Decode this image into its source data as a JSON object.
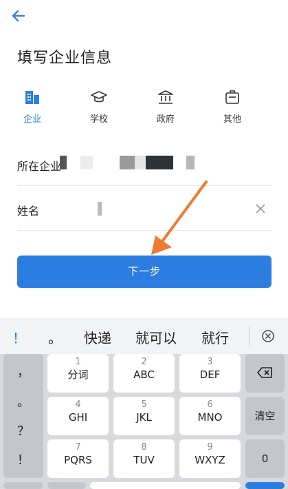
{
  "header": {
    "title": "填写企业信息"
  },
  "tabs": [
    {
      "label": "企业",
      "icon": "building-icon"
    },
    {
      "label": "学校",
      "icon": "graduation-cap-icon"
    },
    {
      "label": "政府",
      "icon": "government-icon"
    },
    {
      "label": "其他",
      "icon": "briefcase-icon"
    }
  ],
  "form": {
    "company_label": "所在企业",
    "name_label": "姓名"
  },
  "next_button": "下一步",
  "colors": {
    "accent": "#2b7de0",
    "arrow": "#f07a2e"
  },
  "keyboard": {
    "candidates": [
      "！",
      "。",
      "快递",
      "就可以",
      "就行"
    ],
    "side_keys": [
      "，",
      "。",
      "？",
      "！"
    ],
    "keys": [
      {
        "num": "1",
        "let": "分词"
      },
      {
        "num": "2",
        "let": "ABC"
      },
      {
        "num": "3",
        "let": "DEF"
      },
      {
        "num": "4",
        "let": "GHI"
      },
      {
        "num": "5",
        "let": "JKL"
      },
      {
        "num": "6",
        "let": "MNO"
      },
      {
        "num": "7",
        "let": "PQRS"
      },
      {
        "num": "8",
        "let": "TUV"
      },
      {
        "num": "9",
        "let": "WXYZ"
      }
    ],
    "clear_label": "清空",
    "zero_label": "0"
  }
}
